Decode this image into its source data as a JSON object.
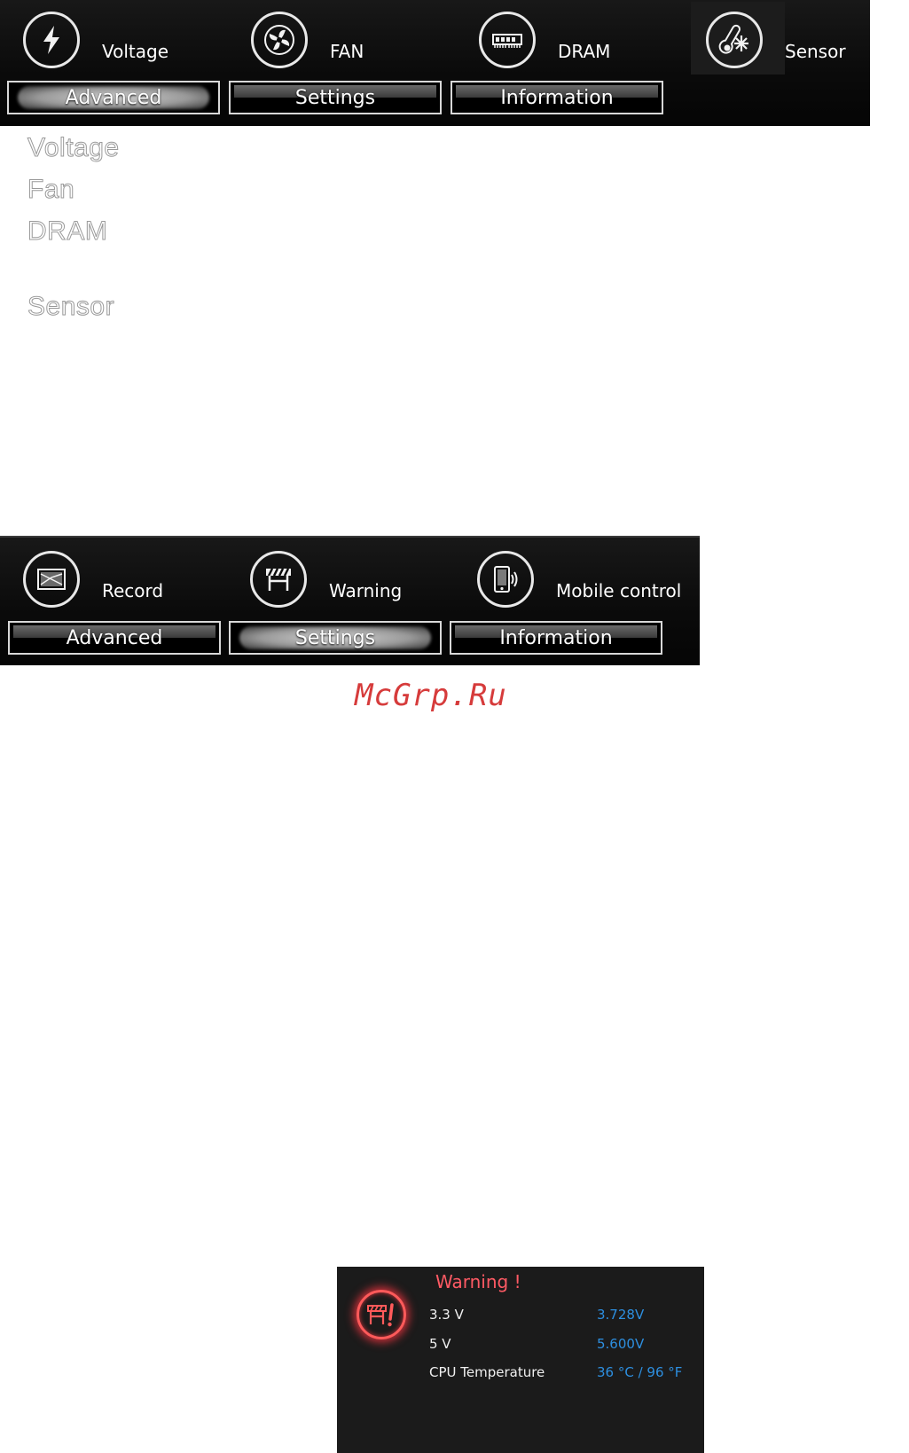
{
  "top_panel": {
    "nav": [
      {
        "label": "Voltage",
        "icon": "lightning-icon"
      },
      {
        "label": "FAN",
        "icon": "fan-icon"
      },
      {
        "label": "DRAM",
        "icon": "dram-icon"
      },
      {
        "label": "Sensor",
        "icon": "thermometer-snowflake-icon"
      }
    ],
    "tabs": [
      {
        "label": "Advanced",
        "active": true
      },
      {
        "label": "Settings",
        "active": false
      },
      {
        "label": "Information",
        "active": false
      }
    ]
  },
  "list": [
    "Voltage",
    "Fan",
    "DRAM",
    "Sensor"
  ],
  "mid_panel": {
    "nav": [
      {
        "label": "Record",
        "icon": "record-icon"
      },
      {
        "label": "Warning",
        "icon": "warning-barrier-icon"
      },
      {
        "label": "Mobile control",
        "icon": "mobile-signal-icon"
      }
    ],
    "tabs": [
      {
        "label": "Advanced",
        "active": false
      },
      {
        "label": "Settings",
        "active": true
      },
      {
        "label": "Information",
        "active": false
      }
    ]
  },
  "watermark": "McGrp.Ru",
  "warning": {
    "title": "Warning !",
    "rows": [
      {
        "label": "3.3 V",
        "value": "3.728V"
      },
      {
        "label": "5 V",
        "value": "5.600V"
      },
      {
        "label": "CPU Temperature",
        "value": "36 °C / 96 °F"
      }
    ]
  },
  "colors": {
    "panel": "#0c0c0c",
    "warning_title": "#ff5a64",
    "warning_value": "#2d8fe0",
    "watermark": "#d63b3b"
  }
}
